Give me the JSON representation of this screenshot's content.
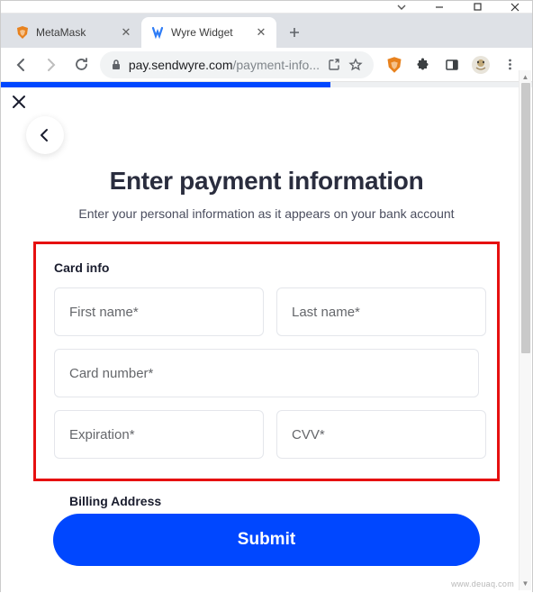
{
  "window": {
    "controls": {
      "min": "—",
      "max": "☐",
      "close": "✕"
    }
  },
  "tabs": [
    {
      "title": "MetaMask",
      "active": false
    },
    {
      "title": "Wyre Widget",
      "active": true
    }
  ],
  "toolbar": {
    "url_host": "pay.sendwyre.com",
    "url_path": "/payment-info..."
  },
  "page": {
    "heading": "Enter payment information",
    "subtitle": "Enter your personal information as it appears on your bank account",
    "card_section_label": "Card info",
    "fields": {
      "first_name": "First name*",
      "last_name": "Last name*",
      "card_number": "Card number*",
      "expiration": "Expiration*",
      "cvv": "CVV*"
    },
    "billing_label": "Billing Address",
    "submit_label": "Submit"
  },
  "watermark": "www.deuaq.com",
  "colors": {
    "accent": "#0047ff",
    "highlight_border": "#e61010"
  }
}
